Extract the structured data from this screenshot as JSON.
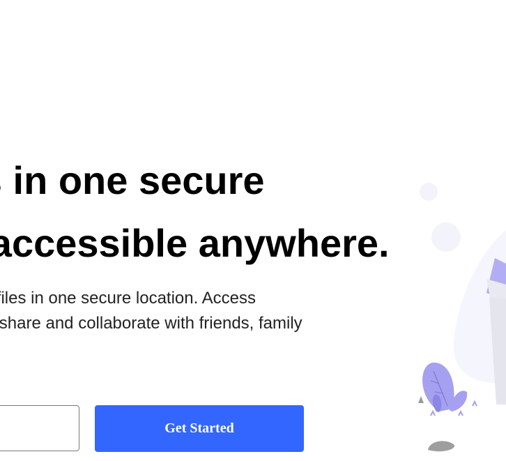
{
  "hero": {
    "title_line1": "your files in one secure",
    "title_line2": "location, accessible anywhere.",
    "subtitle_line1": "Store all your important files in one secure location. Access",
    "subtitle_line2": "them wherever you are, share and collaborate with friends, family"
  },
  "signup": {
    "email_placeholder": "",
    "button_label": "Get Started"
  },
  "colors": {
    "primary": "#3366ff",
    "illustration_accent": "#a5a0ef",
    "illustration_bg": "#f5f5fd"
  },
  "icons": {
    "illustration": "files-plant-illustration"
  }
}
